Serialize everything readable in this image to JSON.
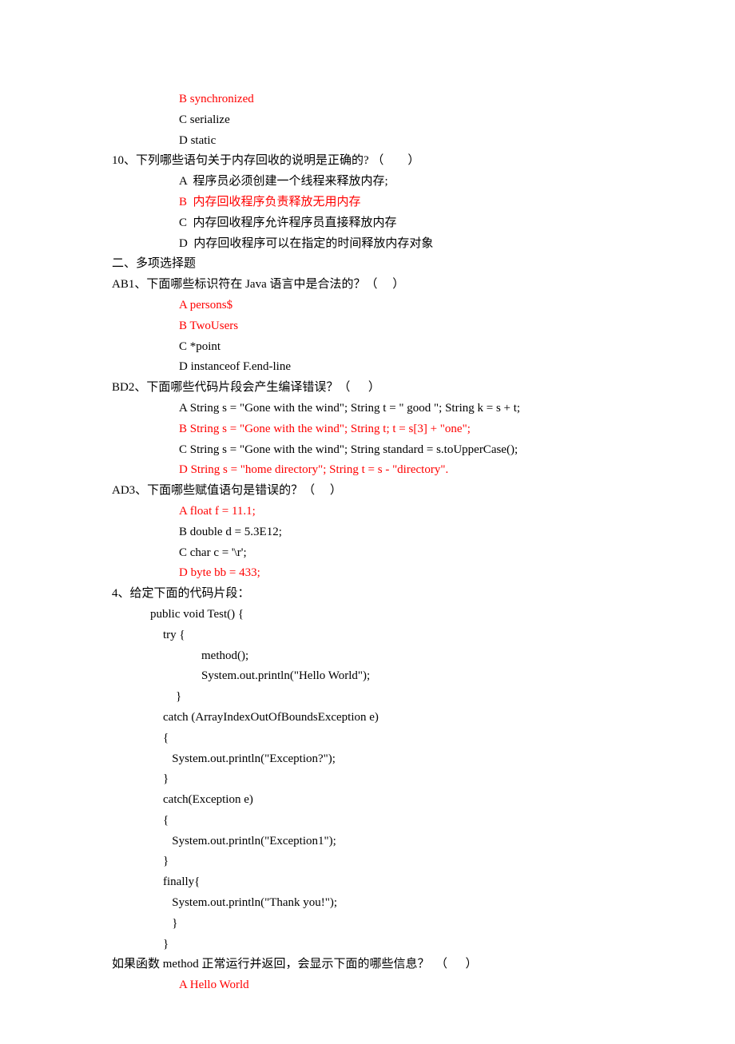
{
  "opts_top": [
    {
      "text": "B synchronized",
      "red": true
    },
    {
      "text": "C serialize",
      "red": false
    },
    {
      "text": "D static",
      "red": false
    }
  ],
  "q10": {
    "label": "10、下列哪些语句关于内存回收的说明是正确的? （        ）",
    "opts": [
      {
        "text": "A  程序员必须创建一个线程来释放内存;",
        "red": false
      },
      {
        "text": "B  内存回收程序负责释放无用内存",
        "red": true
      },
      {
        "text": "C  内存回收程序允许程序员直接释放内存",
        "red": false
      },
      {
        "text": "D  内存回收程序可以在指定的时间释放内存对象",
        "red": false
      }
    ]
  },
  "section2": "二、多项选择题",
  "ab1": {
    "label": "AB1、下面哪些标识符在 Java 语言中是合法的？（     ）",
    "opts": [
      {
        "text": "A persons$",
        "red": true
      },
      {
        "text": "B TwoUsers",
        "red": true
      },
      {
        "text": "C *point",
        "red": false
      },
      {
        "text": "D instanceof F.end-line",
        "red": false
      }
    ]
  },
  "bd2": {
    "label": "BD2、下面哪些代码片段会产生编译错误？（      ）",
    "opts": [
      {
        "text": "A String s = \"Gone with the wind\"; String t = \" good \"; String k = s + t;",
        "red": false
      },
      {
        "text": "B String s = \"Gone with the wind\"; String t; t = s[3] + \"one\";",
        "red": true
      },
      {
        "text": "C String s = \"Gone with the wind\"; String standard = s.toUpperCase();",
        "red": false
      },
      {
        "text": "D String s = \"home directory\"; String t = s - \"directory\".",
        "red": true
      }
    ]
  },
  "ad3": {
    "label": "AD3、下面哪些赋值语句是错误的？（     ）",
    "opts": [
      {
        "text": "A float f = 11.1;",
        "red": true
      },
      {
        "text": "B double d = 5.3E12;",
        "red": false
      },
      {
        "text": "C char c = '\\r';",
        "red": false
      },
      {
        "text": "D byte bb = 433;",
        "red": true
      }
    ]
  },
  "q4": {
    "label": "4、给定下面的代码片段：",
    "codelines": [
      {
        "text": "public void Test() {",
        "cls": "indent1"
      },
      {
        "text": "try {",
        "cls": "indent2"
      },
      {
        "text": "method();",
        "cls": "indent4"
      },
      {
        "text": "System.out.println(\"Hello World\");",
        "cls": "indent4"
      },
      {
        "text": "}",
        "cls": "indent3"
      },
      {
        "text": "catch (ArrayIndexOutOfBoundsException e)",
        "cls": "indent2"
      },
      {
        "text": "{",
        "cls": "indent2"
      },
      {
        "text": "   System.out.println(\"Exception?\");",
        "cls": "indent2"
      },
      {
        "text": "}",
        "cls": "indent2"
      },
      {
        "text": "catch(Exception e)",
        "cls": "indent2"
      },
      {
        "text": "{",
        "cls": "indent2"
      },
      {
        "text": "   System.out.println(\"Exception1\");",
        "cls": "indent2"
      },
      {
        "text": "}",
        "cls": "indent2"
      },
      {
        "text": "finally{",
        "cls": "indent2"
      },
      {
        "text": "   System.out.println(\"Thank you!\");",
        "cls": "indent2"
      },
      {
        "text": "   }",
        "cls": "indent2"
      },
      {
        "text": "}",
        "cls": "indent2"
      }
    ],
    "after": "如果函数 method 正常运行并返回，会显示下面的哪些信息？  （      ）",
    "opts": [
      {
        "text": "A Hello World",
        "red": true
      }
    ]
  }
}
